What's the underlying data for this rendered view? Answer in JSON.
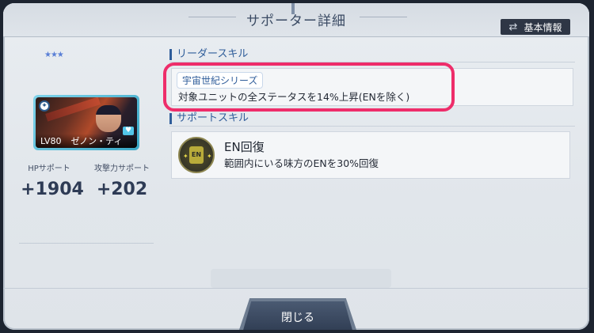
{
  "header": {
    "title": "サポーター詳細",
    "basic_info_label": "基本情報",
    "basic_info_icon": "shuffle-icon"
  },
  "unit": {
    "level": "LV80",
    "name": "ゼノン・ティ",
    "stars": "★★★"
  },
  "stats": [
    {
      "label": "HPサポート",
      "value": "+1904"
    },
    {
      "label": "攻撃力サポート",
      "value": "+202"
    }
  ],
  "leader_skill": {
    "heading": "リーダースキル",
    "tag": "宇宙世紀シリーズ",
    "description": "対象ユニットの全ステータスを14%上昇(ENを除く)"
  },
  "support_skill": {
    "heading": "サポートスキル",
    "icon_text": "EN",
    "name": "EN回復",
    "description": "範囲内にいる味方のENを30%回復"
  },
  "footer": {
    "close_label": "閉じる"
  },
  "colors": {
    "highlight": "#ee2d6a",
    "accent": "#2f5d9a",
    "button_dark": "#2e3645"
  }
}
